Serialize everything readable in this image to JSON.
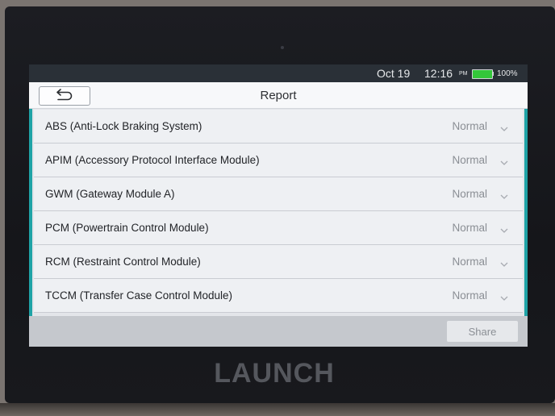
{
  "status_bar": {
    "date": "Oct 19",
    "time": "12:16",
    "ampm": "PM",
    "battery_percent": "100%",
    "battery_level": 1.0
  },
  "header": {
    "back_icon": "back-arrow-icon",
    "title": "Report"
  },
  "modules": [
    {
      "label": "ABS (Anti-Lock Braking System)",
      "status": "Normal"
    },
    {
      "label": "APIM (Accessory Protocol Interface Module)",
      "status": "Normal"
    },
    {
      "label": "GWM (Gateway Module A)",
      "status": "Normal"
    },
    {
      "label": "PCM (Powertrain Control Module)",
      "status": "Normal"
    },
    {
      "label": "RCM (Restraint Control Module)",
      "status": "Normal"
    },
    {
      "label": "TCCM (Transfer Case Control Module)",
      "status": "Normal"
    }
  ],
  "footer": {
    "share_label": "Share"
  },
  "device": {
    "brand": "LAUNCH"
  },
  "colors": {
    "accent": "#1fa3a6",
    "status_bar_bg": "#2a3037",
    "battery": "#34c73a"
  }
}
